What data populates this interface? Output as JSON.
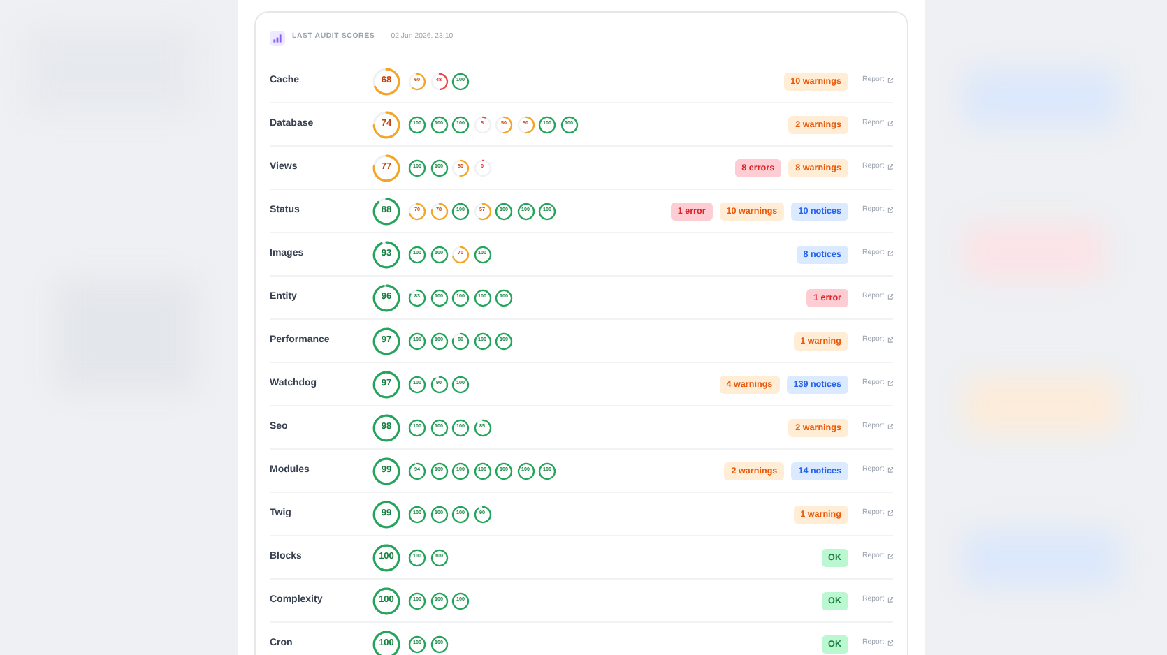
{
  "header": {
    "title": "LAST AUDIT SCORES",
    "timestamp": "— 02 Jun 2026, 23:10"
  },
  "rows": [
    {
      "name": "Cache",
      "score": "68",
      "subs": [
        "60",
        "48",
        "100"
      ],
      "badges": [
        {
          "text": "10 warnings",
          "kind": "warning"
        }
      ],
      "link": "Report"
    },
    {
      "name": "Database",
      "score": "74",
      "subs": [
        "100",
        "100",
        "100",
        "5",
        "50",
        "50",
        "100",
        "100"
      ],
      "badges": [
        {
          "text": "2 warnings",
          "kind": "warning"
        }
      ],
      "link": "Report"
    },
    {
      "name": "Views",
      "score": "77",
      "subs": [
        "100",
        "100",
        "50",
        "0"
      ],
      "badges": [
        {
          "text": "8 errors",
          "kind": "error"
        },
        {
          "text": "8 warnings",
          "kind": "warning"
        }
      ],
      "link": "Report"
    },
    {
      "name": "Status",
      "score": "88",
      "subs": [
        "70",
        "78",
        "100",
        "57",
        "100",
        "100",
        "100"
      ],
      "badges": [
        {
          "text": "1 error",
          "kind": "error"
        },
        {
          "text": "10 warnings",
          "kind": "warning"
        },
        {
          "text": "10 notices",
          "kind": "notice"
        }
      ],
      "link": "Report"
    },
    {
      "name": "Images",
      "score": "93",
      "subs": [
        "100",
        "100",
        "70",
        "100"
      ],
      "badges": [
        {
          "text": "8 notices",
          "kind": "notice"
        }
      ],
      "link": "Report"
    },
    {
      "name": "Entity",
      "score": "96",
      "subs": [
        "83",
        "100",
        "100",
        "100",
        "100"
      ],
      "badges": [
        {
          "text": "1 error",
          "kind": "error"
        }
      ],
      "link": "Report"
    },
    {
      "name": "Performance",
      "score": "97",
      "subs": [
        "100",
        "100",
        "80",
        "100",
        "100"
      ],
      "badges": [
        {
          "text": "1 warning",
          "kind": "warning"
        }
      ],
      "link": "Report"
    },
    {
      "name": "Watchdog",
      "score": "97",
      "subs": [
        "100",
        "90",
        "100"
      ],
      "badges": [
        {
          "text": "4 warnings",
          "kind": "warning"
        },
        {
          "text": "139 notices",
          "kind": "notice"
        }
      ],
      "link": "Report"
    },
    {
      "name": "Seo",
      "score": "98",
      "subs": [
        "100",
        "100",
        "100",
        "85"
      ],
      "badges": [
        {
          "text": "2 warnings",
          "kind": "warning"
        }
      ],
      "link": "Report"
    },
    {
      "name": "Modules",
      "score": "99",
      "subs": [
        "94",
        "100",
        "100",
        "100",
        "100",
        "100",
        "100"
      ],
      "badges": [
        {
          "text": "2 warnings",
          "kind": "warning"
        },
        {
          "text": "14 notices",
          "kind": "notice"
        }
      ],
      "link": "Report"
    },
    {
      "name": "Twig",
      "score": "99",
      "subs": [
        "100",
        "100",
        "100",
        "90"
      ],
      "badges": [
        {
          "text": "1 warning",
          "kind": "warning"
        }
      ],
      "link": "Report"
    },
    {
      "name": "Blocks",
      "score": "100",
      "subs": [
        "100",
        "100"
      ],
      "badges": [
        {
          "text": "OK",
          "kind": "ok"
        }
      ],
      "link": "Report"
    },
    {
      "name": "Complexity",
      "score": "100",
      "subs": [
        "100",
        "100",
        "100"
      ],
      "badges": [
        {
          "text": "OK",
          "kind": "ok"
        }
      ],
      "link": "Report"
    },
    {
      "name": "Cron",
      "score": "100",
      "subs": [
        "100",
        "100"
      ],
      "badges": [
        {
          "text": "OK",
          "kind": "ok"
        }
      ],
      "link": "Report"
    }
  ]
}
